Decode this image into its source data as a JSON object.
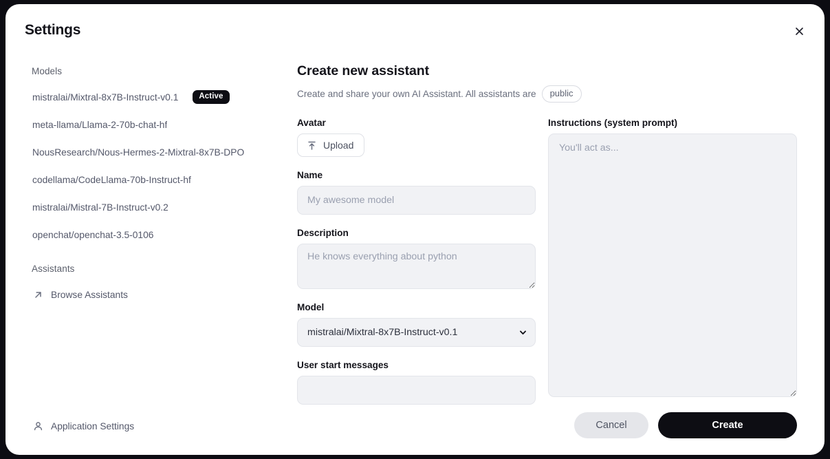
{
  "window": {
    "title": "Settings",
    "close_icon": "close-icon"
  },
  "sidebar": {
    "models_label": "Models",
    "models": [
      {
        "name": "mistralai/Mixtral-8x7B-Instruct-v0.1",
        "badge": "Active"
      },
      {
        "name": "meta-llama/Llama-2-70b-chat-hf",
        "badge": ""
      },
      {
        "name": "NousResearch/Nous-Hermes-2-Mixtral-8x7B-DPO",
        "badge": ""
      },
      {
        "name": "codellama/CodeLlama-70b-Instruct-hf",
        "badge": ""
      },
      {
        "name": "mistralai/Mistral-7B-Instruct-v0.2",
        "badge": ""
      },
      {
        "name": "openchat/openchat-3.5-0106",
        "badge": ""
      }
    ],
    "assistants_label": "Assistants",
    "browse_assistants": "Browse Assistants",
    "browse_icon": "arrow-up-right-icon",
    "application_settings": "Application Settings",
    "application_settings_icon": "user-icon"
  },
  "main": {
    "title": "Create new assistant",
    "subtitle": "Create and share your own AI Assistant. All assistants are",
    "visibility_pill": "public",
    "avatar": {
      "label": "Avatar",
      "upload_label": "Upload",
      "upload_icon": "upload-icon"
    },
    "name": {
      "label": "Name",
      "value": "",
      "placeholder": "My awesome model"
    },
    "description": {
      "label": "Description",
      "value": "",
      "placeholder": "He knows everything about python"
    },
    "model": {
      "label": "Model",
      "selected": "mistralai/Mixtral-8x7B-Instruct-v0.1",
      "chevron_icon": "chevron-down-icon",
      "options": [
        "mistralai/Mixtral-8x7B-Instruct-v0.1",
        "meta-llama/Llama-2-70b-chat-hf",
        "NousResearch/Nous-Hermes-2-Mixtral-8x7B-DPO",
        "codellama/CodeLlama-70b-Instruct-hf",
        "mistralai/Mistral-7B-Instruct-v0.2",
        "openchat/openchat-3.5-0106"
      ]
    },
    "user_start_messages": {
      "label": "User start messages",
      "value": "",
      "placeholder": ""
    },
    "instructions": {
      "label": "Instructions (system prompt)",
      "value": "",
      "placeholder": "You'll act as..."
    },
    "cancel_label": "Cancel",
    "create_label": "Create"
  },
  "colors": {
    "accent": "#0d0d13",
    "field_bg": "#f1f2f5",
    "page_bg": "#0c0c12",
    "muted_text": "#6a6f7e"
  }
}
